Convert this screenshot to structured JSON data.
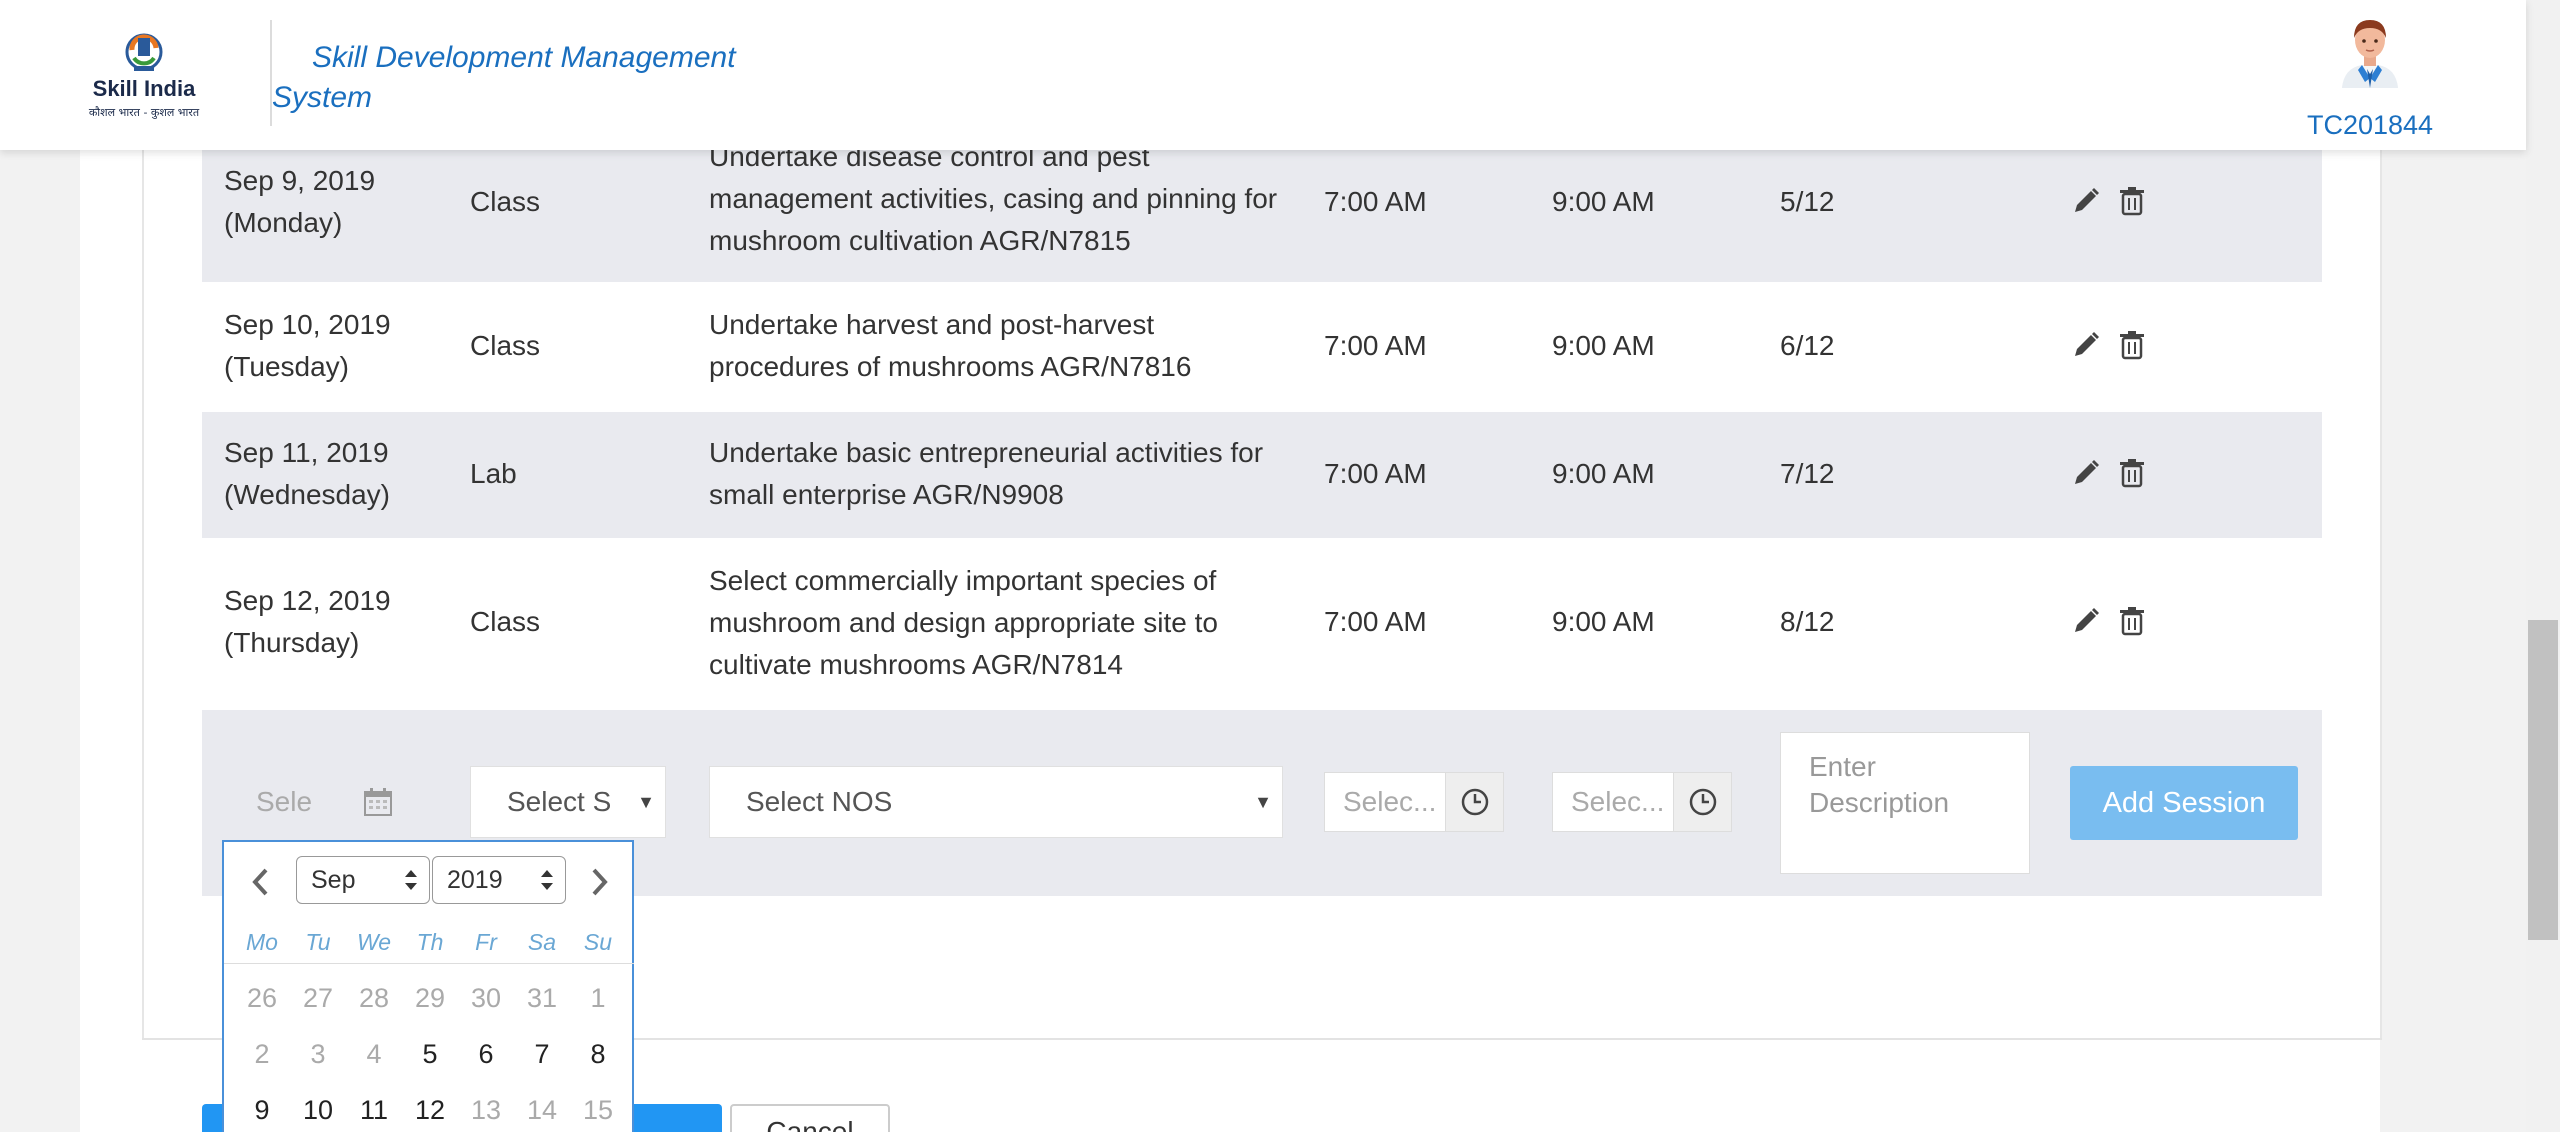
{
  "header": {
    "logo_text": "Skill India",
    "logo_subtext": "कौशल भारत - कुशल भारत",
    "app_title": "Skill Development Management System",
    "user_id": "TC201844"
  },
  "sessions": [
    {
      "date": "Sep 9, 2019",
      "day": "(Monday)",
      "type": "Class",
      "nos": "Undertake disease control and pest management activities, casing and pinning for mushroom cultivation AGR/N7815",
      "start": "7:00 AM",
      "end": "9:00 AM",
      "progress": "5/12"
    },
    {
      "date": "Sep 10, 2019",
      "day": "(Tuesday)",
      "type": "Class",
      "nos": "Undertake harvest and post-harvest procedures of mushrooms  AGR/N7816",
      "start": "7:00 AM",
      "end": "9:00 AM",
      "progress": "6/12"
    },
    {
      "date": "Sep 11, 2019",
      "day": "(Wednesday)",
      "type": "Lab",
      "nos": "Undertake basic entrepreneurial activities for small enterprise AGR/N9908",
      "start": "7:00 AM",
      "end": "9:00 AM",
      "progress": "7/12"
    },
    {
      "date": "Sep 12, 2019",
      "day": "(Thursday)",
      "type": "Class",
      "nos": "Select commercially important species of mushroom and design appropriate site to cultivate mushrooms AGR/N7814",
      "start": "7:00 AM",
      "end": "9:00 AM",
      "progress": "8/12"
    }
  ],
  "form": {
    "date_placeholder": "Sele",
    "type_placeholder": "Select S",
    "nos_placeholder": "Select NOS",
    "start_placeholder": "Selec...",
    "end_placeholder": "Selec...",
    "desc_placeholder": "Enter Description",
    "add_label": "Add Session"
  },
  "bottom": {
    "cancel_label": "Cancel"
  },
  "datepicker": {
    "month": "Sep",
    "year": "2019",
    "dows": [
      "Mo",
      "Tu",
      "We",
      "Th",
      "Fr",
      "Sa",
      "Su"
    ],
    "weeks": [
      [
        {
          "d": "26",
          "m": true
        },
        {
          "d": "27",
          "m": true
        },
        {
          "d": "28",
          "m": true
        },
        {
          "d": "29",
          "m": true
        },
        {
          "d": "30",
          "m": true
        },
        {
          "d": "31",
          "m": true
        },
        {
          "d": "1",
          "m": true
        }
      ],
      [
        {
          "d": "2",
          "m": true
        },
        {
          "d": "3",
          "m": true
        },
        {
          "d": "4",
          "m": true
        },
        {
          "d": "5",
          "m": false
        },
        {
          "d": "6",
          "m": false
        },
        {
          "d": "7",
          "m": false
        },
        {
          "d": "8",
          "m": false
        }
      ],
      [
        {
          "d": "9",
          "m": false
        },
        {
          "d": "10",
          "m": false
        },
        {
          "d": "11",
          "m": false
        },
        {
          "d": "12",
          "m": false
        },
        {
          "d": "13",
          "m": true
        },
        {
          "d": "14",
          "m": true
        },
        {
          "d": "15",
          "m": true
        }
      ]
    ]
  },
  "colors": {
    "brand_blue": "#1a6fbf",
    "add_button": "#79bdf0",
    "row_alt": "#e9eaef",
    "datepicker_border": "#4a90d9"
  },
  "icons": [
    "edit-pencil-icon",
    "delete-trash-icon",
    "calendar-icon",
    "clock-icon",
    "chevron-left-icon",
    "chevron-right-icon",
    "dropdown-caret-icon",
    "avatar-icon"
  ]
}
